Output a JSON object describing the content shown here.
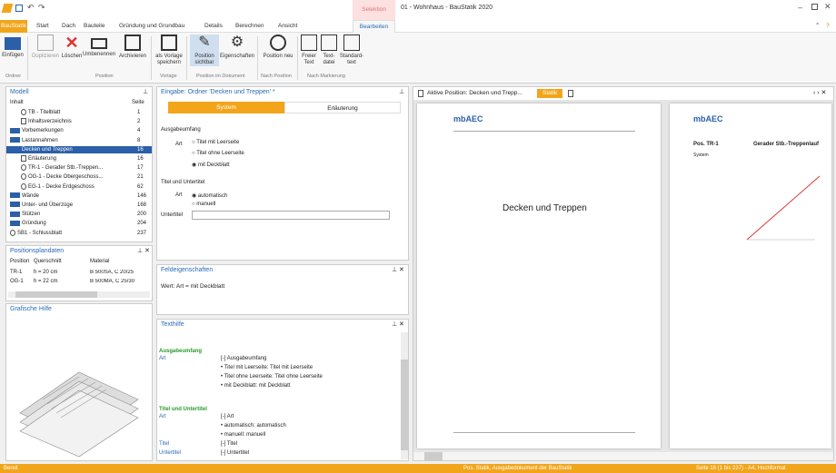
{
  "window": {
    "title": "01 - Wohnhaus - BauStatik 2020",
    "selection_tab": "Selektion"
  },
  "tabs": [
    "BauStatik",
    "Start",
    "Dach",
    "Bauteile",
    "Gründung und Grundbau",
    "Details",
    "Berechnen",
    "Ansicht",
    "Bearbeiten"
  ],
  "ribbon": {
    "buttons": [
      "Einfügen",
      "Duplizieren",
      "Löschen",
      "Umbenennen",
      "Archivieren",
      "als Vorlage speichern",
      "Position sichtbar",
      "Eigenschaften",
      "Position neu",
      "Freier Text",
      "Text-datei",
      "Standard-text"
    ],
    "groups": [
      "Ordner",
      "Position",
      "Vorlage",
      "Position im Dokument",
      "Nach Position",
      "Nach Markierung"
    ]
  },
  "model": {
    "title": "Modell",
    "col_content": "Inhalt",
    "col_page": "Seite",
    "rows": [
      {
        "label": "TB - Titelblatt",
        "page": "1",
        "indent": 1,
        "kind": "pos"
      },
      {
        "label": "Inhaltsverzeichnis",
        "page": "2",
        "indent": 1,
        "kind": "doc"
      },
      {
        "label": "Vorbemerkungen",
        "page": "4",
        "indent": 0,
        "kind": "folder"
      },
      {
        "label": "Lastannahmen",
        "page": "8",
        "indent": 0,
        "kind": "folder"
      },
      {
        "label": "Decken und Treppen",
        "page": "16",
        "indent": 0,
        "kind": "folder",
        "selected": true
      },
      {
        "label": "Erläuterung",
        "page": "16",
        "indent": 1,
        "kind": "doc"
      },
      {
        "label": "TR-1 - Gerader Stb.-Treppen...",
        "page": "17",
        "indent": 1,
        "kind": "pos"
      },
      {
        "label": "OG-1 - Decke Obergeschoss...",
        "page": "21",
        "indent": 1,
        "kind": "pos"
      },
      {
        "label": "EG-1 - Decke Erdgeschoss",
        "page": "62",
        "indent": 1,
        "kind": "pos"
      },
      {
        "label": "Wände",
        "page": "146",
        "indent": 0,
        "kind": "folder"
      },
      {
        "label": "Unter- und Überzüge",
        "page": "168",
        "indent": 0,
        "kind": "folder"
      },
      {
        "label": "Stützen",
        "page": "200",
        "indent": 0,
        "kind": "folder"
      },
      {
        "label": "Gründung",
        "page": "204",
        "indent": 0,
        "kind": "folder"
      },
      {
        "label": "SB1 - Schlussblatt",
        "page": "237",
        "indent": 0,
        "kind": "pos"
      }
    ]
  },
  "positionsplan": {
    "title": "Positionsplandaten",
    "headers": [
      "Position",
      "Querschnitt",
      "Material"
    ],
    "rows": [
      [
        "TR-1",
        "h = 20 cm",
        "B 500SA, C 20/25"
      ],
      [
        "OG-1",
        "h = 22 cm",
        "B 500MA, C 25/30"
      ]
    ]
  },
  "grafik": {
    "title": "Grafische Hilfe"
  },
  "eingabe": {
    "title": "Eingabe: Ordner 'Decken und Treppen' *",
    "tab_system": "System",
    "tab_erl": "Erläuterung",
    "sec1": "Ausgabeumfang",
    "art": "Art",
    "opt1": "Titel mit Leerseite",
    "opt2": "Titel ohne Leerseite",
    "opt3": "mit Deckblatt",
    "sec2": "Titel und Untertitel",
    "art2": "Art",
    "opt4": "automatisch",
    "opt5": "manuell",
    "untertitel": "Untertitel"
  },
  "feld": {
    "title": "Feldeigenschaften",
    "value": "Wert: Art = mit Deckblatt"
  },
  "texthilfe": {
    "title": "Texthilfe",
    "h1": "Ausgabeumfang",
    "art": "Art",
    "l1": "[-]  Ausgabeumfang",
    "l2": "• Titel mit Leerseite: Titel mit Leerseite",
    "l3": "• Titel ohne Leerseite: Titel ohne Leerseite",
    "l4": "• mit Deckblatt: mit Deckblatt",
    "h2": "Titel und Untertitel",
    "art2": "Art",
    "l5": "[-]  Art",
    "l6": "• automatisch: automatisch",
    "l7": "• manuell: manuell",
    "titel": "Titel",
    "l8": "[-]  Titel",
    "untertitel": "Untertitel",
    "l9": "[-]  Untertitel"
  },
  "preview": {
    "title": "Aktive Position: Decken und Trepp...",
    "statik": "Statik",
    "page_title": "Decken und Treppen",
    "pos_head": "Pos. TR-1",
    "pos_head2": "Gerader Stb.-Treppenlauf",
    "system": "System",
    "logo": "mbAEC"
  },
  "status": {
    "left": "Bereit",
    "center": "Pos. Statik, Ausgabedokument der BauStatik",
    "right": "Seite 16 (1 bis 237) - A4, Hochformat"
  },
  "colors": {
    "accent": "#2a6ab5",
    "orange": "#f2a51b",
    "folder": "#2b5fa8"
  }
}
